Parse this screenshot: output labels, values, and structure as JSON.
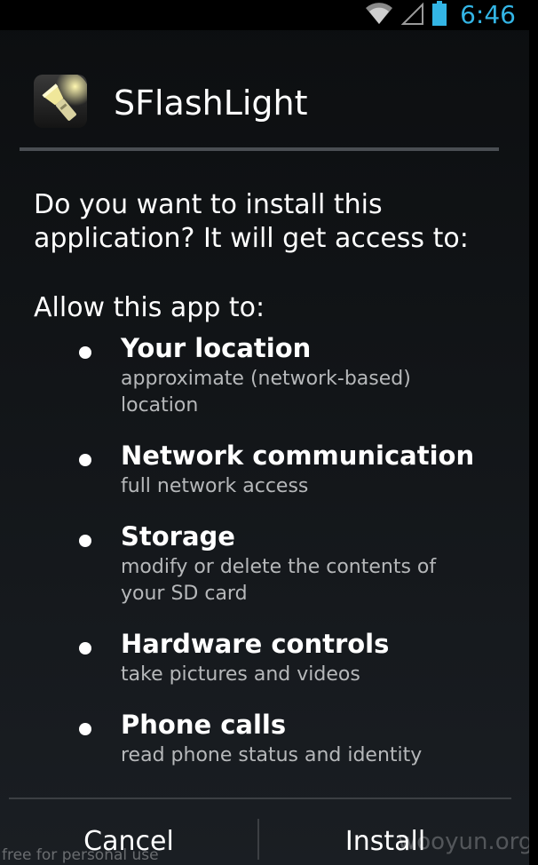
{
  "status_bar": {
    "time": "6:46",
    "icons": [
      "wifi-icon",
      "signal-icon",
      "battery-icon"
    ],
    "accent_color": "#33b5e5"
  },
  "header": {
    "app_name": "SFlashLight",
    "app_icon": "flashlight-icon"
  },
  "body": {
    "question": "Do you want to install this application? It will get access to:",
    "allow_label": "Allow this app to:"
  },
  "permissions": [
    {
      "title": "Your location",
      "description": "approximate (network-based) location"
    },
    {
      "title": "Network communication",
      "description": "full network access"
    },
    {
      "title": "Storage",
      "description": "modify or delete the contents of your SD card"
    },
    {
      "title": "Hardware controls",
      "description": "take pictures and videos"
    },
    {
      "title": "Phone calls",
      "description": "read phone status and identity"
    }
  ],
  "buttons": {
    "cancel": "Cancel",
    "install": "Install"
  },
  "watermarks": {
    "left": "free for personal use",
    "right": "wooyun.org"
  }
}
